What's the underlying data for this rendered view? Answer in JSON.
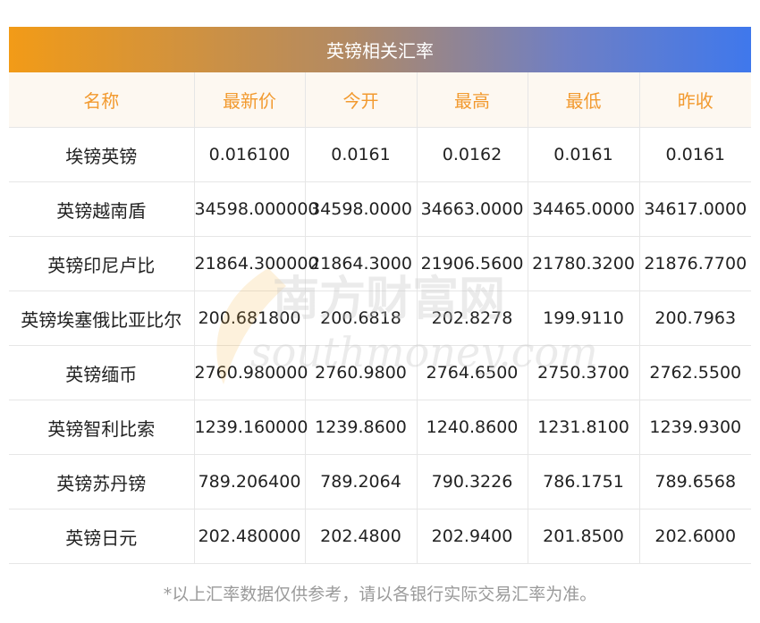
{
  "title": "英镑相关汇率",
  "headers": [
    "名称",
    "最新价",
    "今开",
    "最高",
    "最低",
    "昨收"
  ],
  "rows": [
    [
      "埃镑英镑",
      "0.016100",
      "0.0161",
      "0.0162",
      "0.0161",
      "0.0161"
    ],
    [
      "英镑越南盾",
      "34598.000000",
      "34598.0000",
      "34663.0000",
      "34465.0000",
      "34617.0000"
    ],
    [
      "英镑印尼卢比",
      "21864.300000",
      "21864.3000",
      "21906.5600",
      "21780.3200",
      "21876.7700"
    ],
    [
      "英镑埃塞俄比亚比尔",
      "200.681800",
      "200.6818",
      "202.8278",
      "199.9110",
      "200.7963"
    ],
    [
      "英镑缅币",
      "2760.980000",
      "2760.9800",
      "2764.6500",
      "2750.3700",
      "2762.5500"
    ],
    [
      "英镑智利比索",
      "1239.160000",
      "1239.8600",
      "1240.8600",
      "1231.8100",
      "1239.9300"
    ],
    [
      "英镑苏丹镑",
      "789.206400",
      "789.2064",
      "790.3226",
      "786.1751",
      "789.6568"
    ],
    [
      "英镑日元",
      "202.480000",
      "202.4800",
      "202.9400",
      "201.8500",
      "202.6000"
    ]
  ],
  "watermark": {
    "cn": "南方财富网",
    "en": "southmoney.com"
  },
  "footnote": "*以上汇率数据仅供参考，请以各银行实际交易汇率为准。",
  "colors": {
    "header_text": "#f29a2f",
    "header_bg": "#fdf8f1",
    "title_gradient_start": "#f29b17",
    "title_gradient_end": "#3f78ec",
    "footnote": "#9a9a9a"
  }
}
